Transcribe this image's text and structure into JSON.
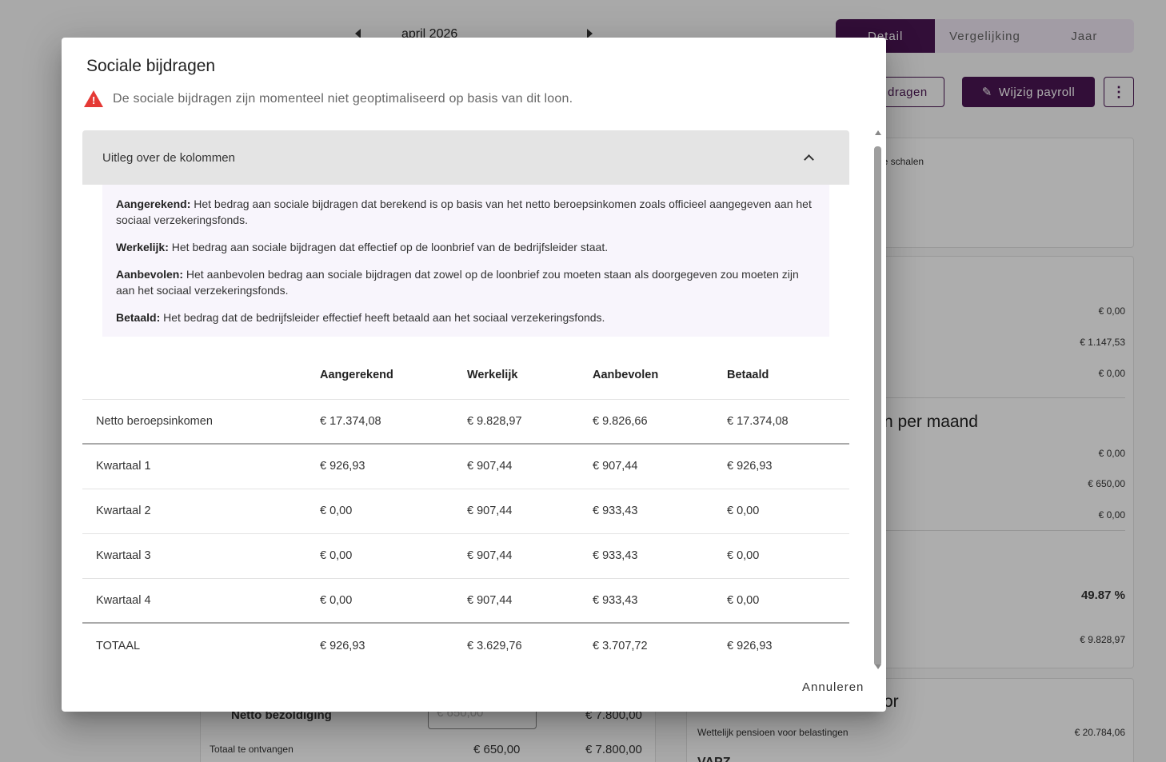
{
  "background": {
    "month": "april 2026",
    "view_tabs": [
      "Detail",
      "Vergelijking",
      "Jaar"
    ],
    "sociale_bijdragen_button": "dragen",
    "edit_payroll_button": "Wijzig payroll",
    "more_button": "⋮",
    "scales_label": "jke schalen",
    "values_top": [
      "€ 0,00",
      "€ 1.147,53",
      "€ 0,00"
    ],
    "per_month_heading": "n per maand",
    "values_mid": [
      "€ 0,00",
      "€ 650,00",
      "€ 0,00"
    ],
    "percentage": "49.87 %",
    "net_value": "€ 9.828,97",
    "section_heading_partial": "or",
    "pension_label": "Wettelijk pensioen voor belastingen",
    "pension_value": "€ 20.784,06",
    "vapz_partial": "VAPZ",
    "netto_bezoldiging_label": "Netto bezoldiging",
    "netto_field_value": "€ 650,00",
    "netto_yearly": "€ 7.800,00",
    "totaal_label": "Totaal te ontvangen",
    "totaal_monthly": "€ 650,00",
    "totaal_yearly": "€ 7.800,00"
  },
  "dialog": {
    "title": "Sociale bijdragen",
    "warning": "De sociale bijdragen zijn momenteel niet geoptimaliseerd op basis van dit loon.",
    "warning_color": "#e53935",
    "explanation_header": "Uitleg over de kolommen",
    "explanations": [
      {
        "term": "Aangerekend:",
        "text": " Het bedrag aan sociale bijdragen dat berekend is op basis van het netto beroepsinkomen zoals officieel aangegeven aan het sociaal verzekeringsfonds."
      },
      {
        "term": "Werkelijk:",
        "text": " Het bedrag aan sociale bijdragen dat effectief op de loonbrief van de bedrijfsleider staat."
      },
      {
        "term": "Aanbevolen:",
        "text": " Het aanbevolen bedrag aan sociale bijdragen dat zowel op de loonbrief zou moeten staan als doorgegeven zou moeten zijn aan het sociaal verzekeringsfonds."
      },
      {
        "term": "Betaald:",
        "text": " Het bedrag dat de bedrijfsleider effectief heeft betaald aan het sociaal verzekeringsfonds."
      }
    ],
    "table": {
      "headers": [
        "",
        "Aangerekend",
        "Werkelijk",
        "Aanbevolen",
        "Betaald"
      ],
      "rows": [
        [
          "Netto beroepsinkomen",
          "€ 17.374,08",
          "€ 9.828,97",
          "€ 9.826,66",
          "€ 17.374,08"
        ],
        [
          "Kwartaal 1",
          "€ 926,93",
          "€ 907,44",
          "€ 907,44",
          "€ 926,93"
        ],
        [
          "Kwartaal 2",
          "€ 0,00",
          "€ 907,44",
          "€ 933,43",
          "€ 0,00"
        ],
        [
          "Kwartaal 3",
          "€ 0,00",
          "€ 907,44",
          "€ 933,43",
          "€ 0,00"
        ],
        [
          "Kwartaal 4",
          "€ 0,00",
          "€ 907,44",
          "€ 933,43",
          "€ 0,00"
        ],
        [
          "TOTAAL",
          "€ 926,93",
          "€ 3.629,76",
          "€ 3.707,72",
          "€ 926,93"
        ]
      ]
    },
    "cancel_button": "Annuleren"
  },
  "colors": {
    "brand": "#4a1553",
    "toggle_bg": "#efe6f4",
    "explanation_bg": "#f8f5fc"
  }
}
